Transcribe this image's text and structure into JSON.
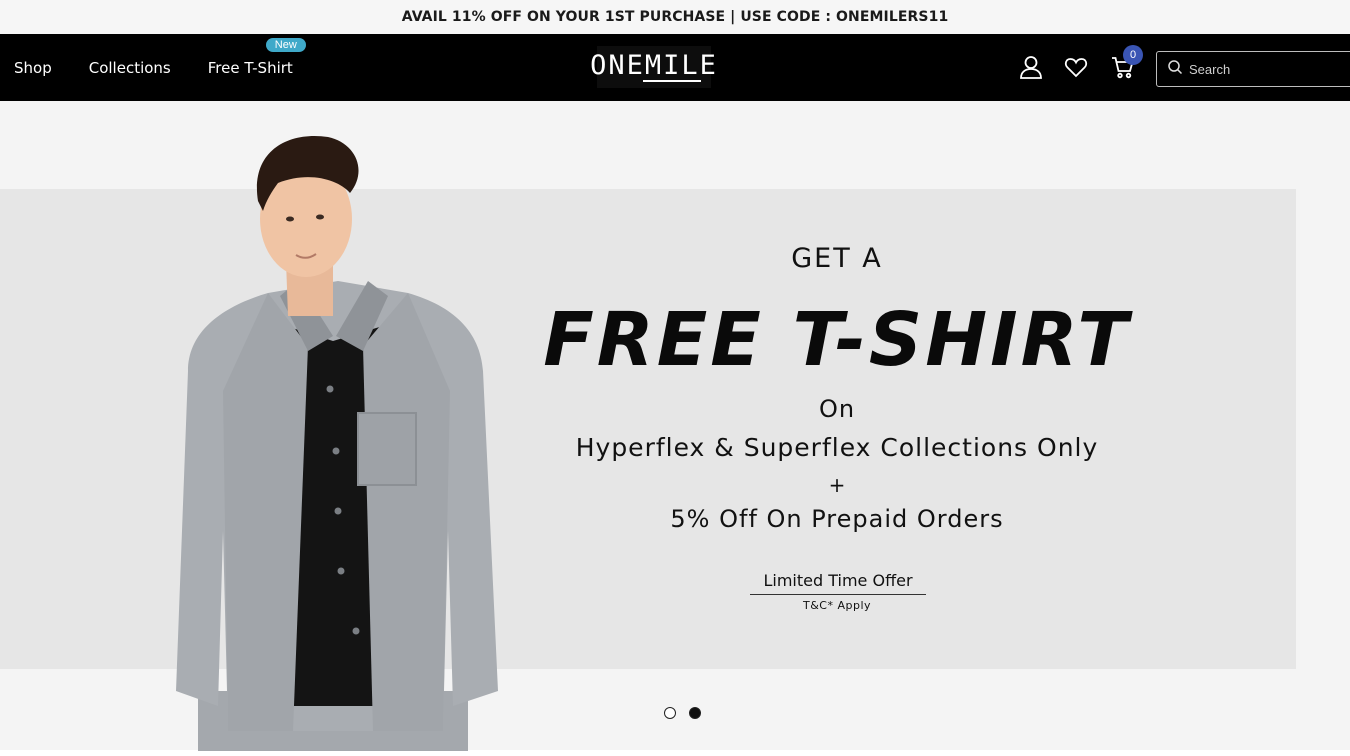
{
  "announcement": {
    "text": "AVAIL 11% OFF ON YOUR 1ST PURCHASE | USE CODE : ONEMILERS11"
  },
  "nav": {
    "links": [
      {
        "label": "Shop"
      },
      {
        "label": "Collections"
      },
      {
        "label": "Free T-Shirt",
        "badge": "New"
      }
    ],
    "logo": "ONEMILE",
    "icons": [
      "user-icon",
      "heart-icon",
      "cart-icon",
      "search-icon"
    ],
    "cart_count": "0",
    "search_placeholder": "Search",
    "badge_color": "#3fa9c9",
    "cart_badge_color": "#3a55b4"
  },
  "hero": {
    "headline_small": "GET A",
    "headline_main": "FREE T-SHIRT",
    "on_text": "On",
    "collections_text": "Hyperflex & Superflex Collections Only",
    "plus": "+",
    "prepaid_text": "5% Off On Prepaid Orders",
    "limited_text": "Limited Time Offer",
    "tnc_text": "T&C* Apply",
    "slides": 2,
    "active_slide": 2
  }
}
